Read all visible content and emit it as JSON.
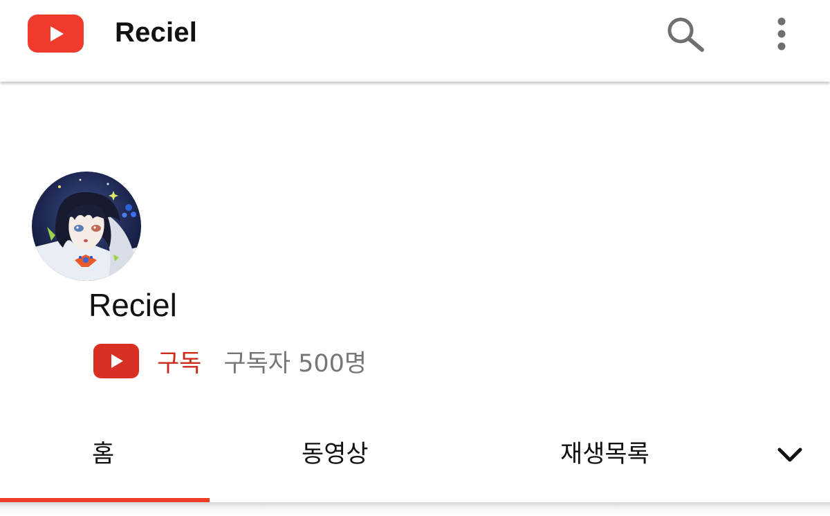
{
  "header": {
    "title": "Reciel",
    "logo_icon": "youtube-play-icon",
    "search_icon": "search-icon",
    "more_icon": "more-vertical-icon",
    "brand_color": "#f03a2b"
  },
  "channel": {
    "name": "Reciel",
    "subscribe_label": "구독",
    "subscriber_count": "구독자 500명",
    "subscribe_color": "#cc2a1b"
  },
  "tabs": {
    "items": [
      {
        "label": "홈",
        "active": true
      },
      {
        "label": "동영상",
        "active": false
      },
      {
        "label": "재생목록",
        "active": false
      }
    ],
    "more_icon": "chevron-down-icon",
    "indicator_color": "#ee3b25"
  }
}
